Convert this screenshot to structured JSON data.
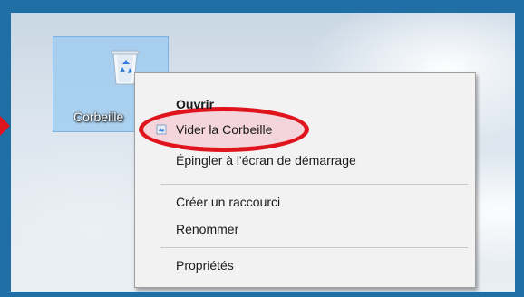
{
  "desktop": {
    "recycle_bin": {
      "label": "Corbeille",
      "icon": "recycle-bin-icon"
    },
    "annotation": {
      "arrow_color": "#e0141c",
      "highlight_color": "#e0141c"
    }
  },
  "context_menu": {
    "items": [
      {
        "label": "Ouvrir",
        "default": true
      },
      {
        "label": "Vider la Corbeille",
        "icon": "recycle-small-icon"
      },
      {
        "label": "Épingler à l'écran de démarrage"
      },
      {
        "label": "Créer un raccourci"
      },
      {
        "label": "Renommer"
      },
      {
        "label": "Propriétés"
      }
    ]
  },
  "colors": {
    "frame": "#1f6fa5",
    "selection": "#99c9f0",
    "menu_bg": "#f2f2f2"
  }
}
